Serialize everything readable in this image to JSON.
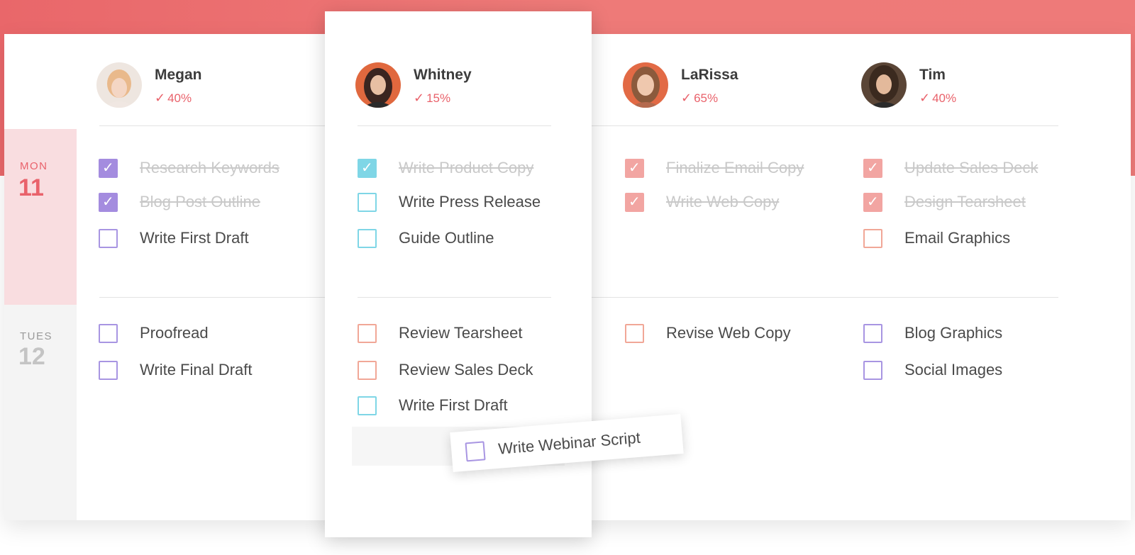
{
  "days": [
    {
      "name": "MON",
      "num": "11"
    },
    {
      "name": "TUES",
      "num": "12"
    }
  ],
  "people": [
    {
      "name": "Megan",
      "percent": "40%",
      "avatar": "megan-avatar",
      "mon": [
        {
          "label": "Research Keywords",
          "done": true
        },
        {
          "label": "Blog Post Outline",
          "done": true
        },
        {
          "label": "Write First Draft",
          "done": false
        }
      ],
      "tue": [
        {
          "label": "Proofread",
          "done": false
        },
        {
          "label": "Write Final Draft",
          "done": false
        }
      ]
    },
    {
      "name": "Whitney",
      "percent": "15%",
      "avatar": "whitney-avatar",
      "mon": [
        {
          "label": "Write Product Copy",
          "done": true
        },
        {
          "label": "Write Press Release",
          "done": false
        },
        {
          "label": "Guide Outline",
          "done": false
        }
      ],
      "tue": [
        {
          "label": "Review Tearsheet",
          "done": false
        },
        {
          "label": "Review Sales Deck",
          "done": false
        },
        {
          "label": "Write First Draft",
          "done": false
        }
      ]
    },
    {
      "name": "LaRissa",
      "percent": "65%",
      "avatar": "larissa-avatar",
      "mon": [
        {
          "label": "Finalize Email Copy",
          "done": true
        },
        {
          "label": "Write Web Copy",
          "done": true
        }
      ],
      "tue": [
        {
          "label": "Revise Web Copy",
          "done": false
        }
      ]
    },
    {
      "name": "Tim",
      "percent": "40%",
      "avatar": "tim-avatar",
      "mon": [
        {
          "label": "Update Sales Deck",
          "done": true
        },
        {
          "label": "Design Tearsheet",
          "done": true
        },
        {
          "label": "Email Graphics",
          "done": false
        }
      ],
      "tue": [
        {
          "label": "Blog Graphics",
          "done": false
        },
        {
          "label": "Social Images",
          "done": false
        }
      ]
    }
  ],
  "dragging_task": {
    "label": "Write Webinar Script",
    "done": false
  },
  "colors": {
    "banner": "#ec7173",
    "accent": "#e9626b",
    "purple": "#a48cdf",
    "cyan": "#7fd6e6",
    "salmon": "#f2a5a2"
  }
}
